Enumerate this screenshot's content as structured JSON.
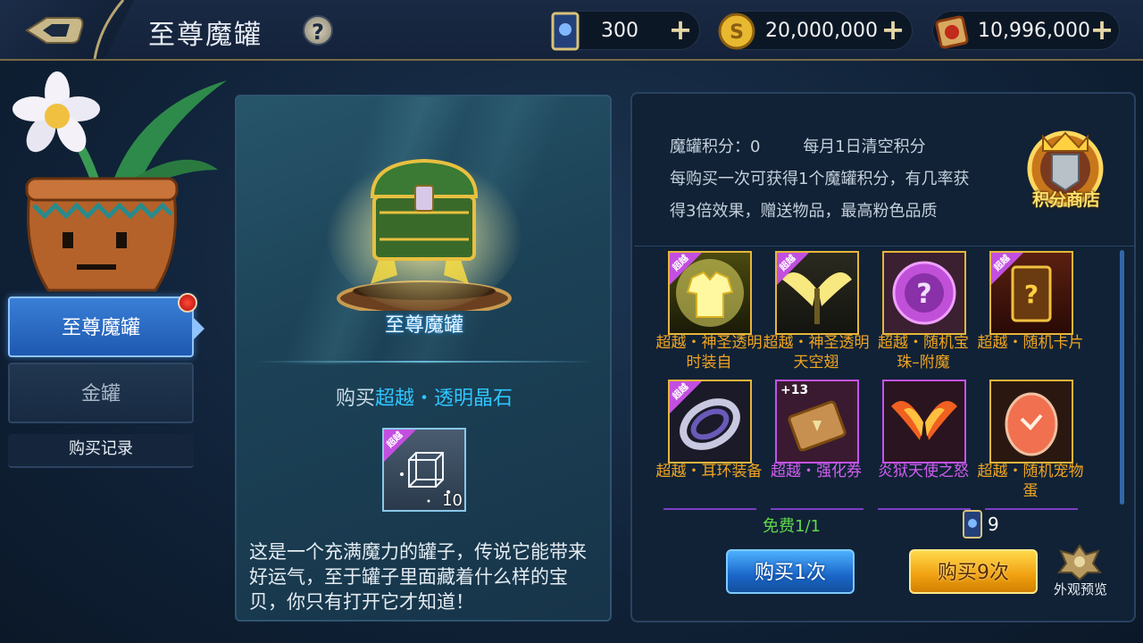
{
  "header": {
    "title": "至尊魔罐",
    "help": "?",
    "resources": [
      {
        "icon": "card-icon",
        "value": "300",
        "plus": "+"
      },
      {
        "icon": "gold-coin-icon",
        "value": "20,000,000",
        "plus": "+"
      },
      {
        "icon": "scroll-icon",
        "value": "10,996,000",
        "plus": "+"
      }
    ]
  },
  "sidebar": {
    "tabs": [
      {
        "label": "至尊魔罐",
        "active": true,
        "badge": true
      },
      {
        "label": "金罐",
        "active": false
      },
      {
        "label": "购买记录",
        "active": false
      }
    ]
  },
  "chest_panel": {
    "chest_name": "至尊魔罐",
    "buy_prefix": "购买",
    "buy_item": "超越・透明晶石",
    "crystal_badge": "超越",
    "crystal_count": "10",
    "description": "这是一个充满魔力的罐子，传说它能带来好运气，至于罐子里面藏着什么样的宝贝，你只有打开它才知道！"
  },
  "reward_panel": {
    "score_label": "魔罐积分：0",
    "monthly_reset": "每月1日清空积分",
    "rule": "每购买一次可获得1个魔罐积分，有几率获得3倍效果，赠送物品，最高粉色品质",
    "shop_label": "积分商店",
    "items": [
      {
        "name": "超越・神圣透明时装自",
        "badge": "超越",
        "color": "gold",
        "icon": "armor-icon"
      },
      {
        "name": "超越・神圣透明天空翅",
        "badge": "超越",
        "color": "gold",
        "icon": "wings-icon"
      },
      {
        "name": "超越・随机宝珠–附魔",
        "badge": "",
        "color": "gold",
        "icon": "orb-icon"
      },
      {
        "name": "超越・随机卡片",
        "badge": "超越",
        "color": "gold",
        "icon": "card-icon"
      },
      {
        "name": "超越・耳环装备",
        "badge": "超越",
        "color": "gold",
        "icon": "earring-icon"
      },
      {
        "name": "超越・强化券",
        "badge": "+13",
        "color": "purple",
        "icon": "ticket-icon"
      },
      {
        "name": "炎狱天使之怒",
        "badge": "",
        "color": "purple",
        "icon": "fire-wings-icon"
      },
      {
        "name": "超越・随机宠物蛋",
        "badge": "",
        "color": "gold",
        "icon": "egg-icon"
      }
    ],
    "free_text": "免费1/1",
    "cost_value": "9",
    "buy_once": "购买1次",
    "buy_nine": "购买9次",
    "preview_label": "外观预览"
  }
}
